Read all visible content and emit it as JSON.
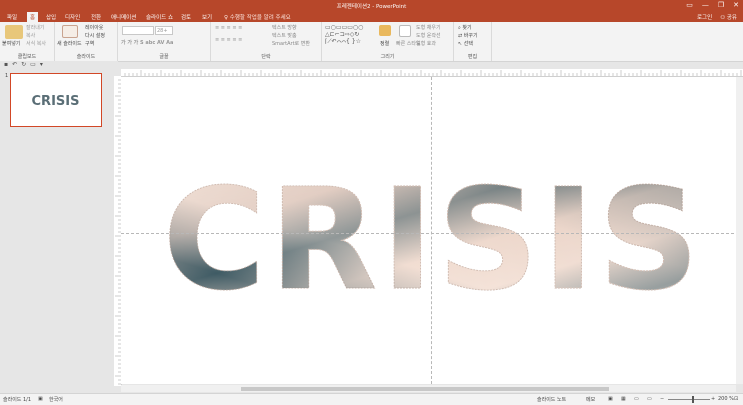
{
  "window": {
    "title": "프레젠테이션2 - PowerPoint",
    "controls": [
      "▭",
      "—",
      "❐",
      "✕"
    ]
  },
  "tabs": [
    "파일",
    "홈",
    "삽입",
    "디자인",
    "전환",
    "애니메이션",
    "슬라이드 쇼",
    "검토",
    "보기"
  ],
  "active_tab_index": 1,
  "tell_me": "수행할 작업을 알려 주세요",
  "account": {
    "login": "로그인",
    "share": "공유"
  },
  "ribbon": {
    "clipboard": {
      "paste": "붙여넣기",
      "cut": "잘라내기",
      "copy": "복사",
      "format": "서식 복사",
      "label": "클립보드"
    },
    "slides": {
      "new": "새 슬라이드",
      "layout": "레이아웃",
      "reset": "다시 설정",
      "section": "구역",
      "label": "슬라이드"
    },
    "font": {
      "size": "28+",
      "label": "글꼴"
    },
    "paragraph": {
      "text_dir": "텍스트 방향",
      "align": "텍스트 맞춤",
      "smartart": "SmartArt로 변환",
      "label": "단락"
    },
    "drawing": {
      "arrange": "정렬",
      "quick": "빠른 스타일",
      "fill": "도형 채우기",
      "outline": "도형 윤곽선",
      "effect": "도형 효과",
      "label": "그리기"
    },
    "editing": {
      "find": "찾기",
      "replace": "바꾸기",
      "select": "선택",
      "label": "편집"
    }
  },
  "slide_number": "1",
  "slide_text": "CRISIS",
  "status": {
    "slide": "슬라이드 1/1",
    "lang": "한국어",
    "notes": "슬라이드 노트",
    "comments": "메모",
    "zoom": "200 %"
  },
  "colors": {
    "accent": "#b7472a",
    "letter_light": "#f2ddd2",
    "letter_dark": "#2e4b55"
  }
}
